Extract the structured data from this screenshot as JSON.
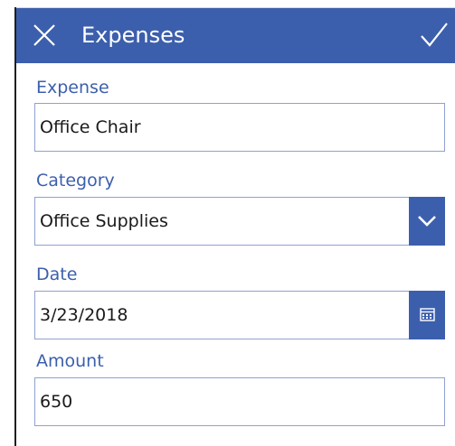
{
  "header": {
    "title": "Expenses",
    "close_icon": "close-icon",
    "submit_icon": "checkmark-icon",
    "color": "#3c5fad"
  },
  "form": {
    "expense": {
      "label": "Expense",
      "value": "Office Chair"
    },
    "category": {
      "label": "Category",
      "value": "Office Supplies",
      "icon": "chevron-down-icon"
    },
    "date": {
      "label": "Date",
      "value": "3/23/2018",
      "icon": "calendar-icon"
    },
    "amount": {
      "label": "Amount",
      "value": "650"
    }
  },
  "colors": {
    "accent": "#3c5fad",
    "field_border": "#8fa1cf",
    "text": "#1a1a1a"
  }
}
